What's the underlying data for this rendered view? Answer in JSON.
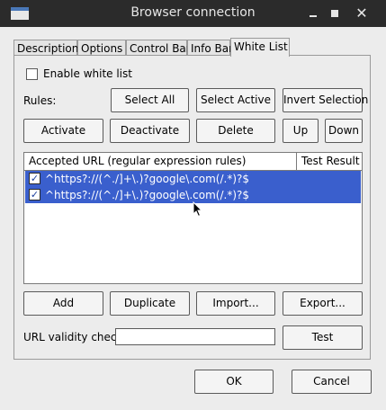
{
  "window": {
    "title": "Browser connection"
  },
  "tabs": [
    {
      "label": "Description"
    },
    {
      "label": "Options"
    },
    {
      "label": "Control Bar"
    },
    {
      "label": "Info Bar"
    },
    {
      "label": "White List",
      "active": true
    }
  ],
  "whitelist": {
    "enable_label": "Enable white list",
    "enable_checked": false,
    "rules_label": "Rules:",
    "buttons": {
      "select_all": "Select All",
      "select_active": "Select Active",
      "invert_selection": "Invert Selection",
      "activate": "Activate",
      "deactivate": "Deactivate",
      "delete": "Delete",
      "up": "Up",
      "down": "Down",
      "add": "Add",
      "duplicate": "Duplicate",
      "import": "Import...",
      "export": "Export...",
      "test": "Test"
    },
    "table": {
      "columns": [
        "Accepted URL (regular expression rules)",
        "Test Result"
      ],
      "rows": [
        {
          "url": "^https?://(^./]+\\.)?google\\.com(/.*)?$",
          "checked": true,
          "selected": true,
          "test_result": ""
        },
        {
          "url": "^https?://(^./]+\\.)?google\\.com(/.*)?$",
          "checked": true,
          "selected": true,
          "test_result": ""
        }
      ]
    },
    "url_check": {
      "label": "URL validity check",
      "value": ""
    }
  },
  "dialog": {
    "ok": "OK",
    "cancel": "Cancel"
  },
  "colors": {
    "titlebar": "#2b2b2b",
    "selection": "#3a5fcd",
    "window": "#ececec"
  }
}
